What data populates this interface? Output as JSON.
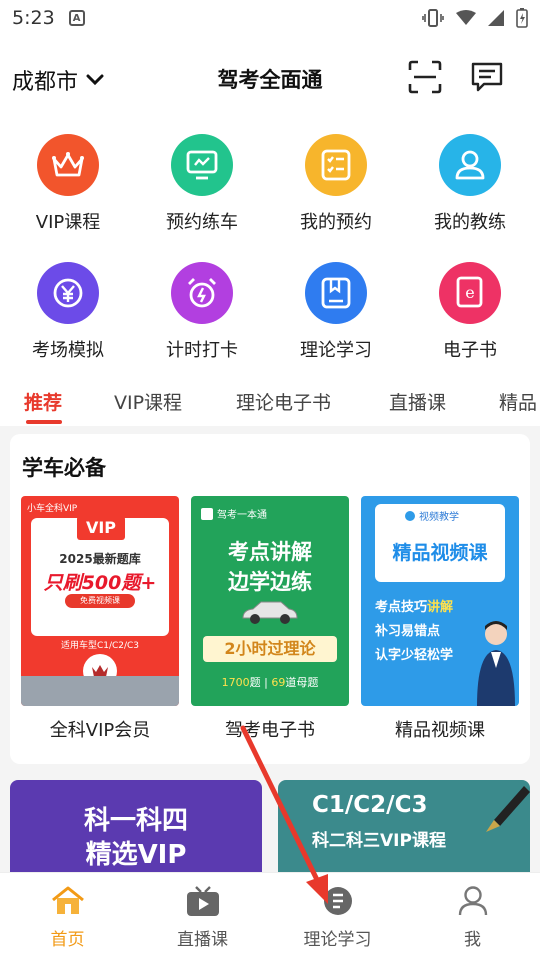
{
  "status": {
    "time": "5:23",
    "a_icon": "A"
  },
  "header": {
    "city": "成都市",
    "title": "驾考全面通"
  },
  "grid": [
    {
      "label": "VIP课程",
      "icon": "crown-icon",
      "color": "#f2552c"
    },
    {
      "label": "预约练车",
      "icon": "monitor-icon",
      "color": "#22c48d"
    },
    {
      "label": "我的预约",
      "icon": "checklist-icon",
      "color": "#f7b52c"
    },
    {
      "label": "我的教练",
      "icon": "coach-icon",
      "color": "#27b4e8"
    },
    {
      "label": "考场模拟",
      "icon": "yen-coin-icon",
      "color": "#6c4be8"
    },
    {
      "label": "计时打卡",
      "icon": "alarm-clock-icon",
      "color": "#b23fe0"
    },
    {
      "label": "理论学习",
      "icon": "book-icon",
      "color": "#2f7cf0"
    },
    {
      "label": "电子书",
      "icon": "ebook-icon",
      "color": "#ee3265"
    }
  ],
  "tabs": [
    {
      "label": "推荐",
      "active": true
    },
    {
      "label": "VIP课程"
    },
    {
      "label": "理论电子书"
    },
    {
      "label": "直播课"
    },
    {
      "label": "精品"
    }
  ],
  "section": {
    "title": "学车必备",
    "items": [
      {
        "label": "全科VIP会员",
        "thumb": {
          "tag": "小车全科VIP",
          "badge": "VIP",
          "line1": "2025最新题库",
          "line2": "只刷500题+",
          "line3": "免费视频课",
          "line4": "适用车型C1/C2/C3"
        }
      },
      {
        "label": "驾考电子书",
        "thumb": {
          "tag": "驾考一本通",
          "line1": "考点讲解",
          "line2": "边学边练",
          "line3": "2小时过理论",
          "stat1": "1700",
          "stat1_unit": "题",
          "stat2": "69",
          "stat2_unit": "道母题"
        }
      },
      {
        "label": "精品视频课",
        "thumb": {
          "tag": "视频教学",
          "line1": "精品视频课",
          "line2": "考点技巧",
          "line2_accent": "讲解",
          "line3": "补习易错点",
          "line4": "认字少轻松学"
        }
      }
    ]
  },
  "banners": [
    {
      "line1": "科一科四",
      "line2": "精选VIP",
      "color": "#5b3ab0"
    },
    {
      "line1": "C1/C2/C3",
      "line2": "科二科三VIP课程",
      "color": "#3b8a8c"
    }
  ],
  "bottom_nav": [
    {
      "label": "首页",
      "icon": "home-icon",
      "active": true
    },
    {
      "label": "直播课",
      "icon": "tv-play-icon"
    },
    {
      "label": "理论学习",
      "icon": "study-icon"
    },
    {
      "label": "我",
      "icon": "person-icon"
    }
  ],
  "colors": {
    "accent": "#e8392c",
    "nav_active": "#f29a16"
  }
}
